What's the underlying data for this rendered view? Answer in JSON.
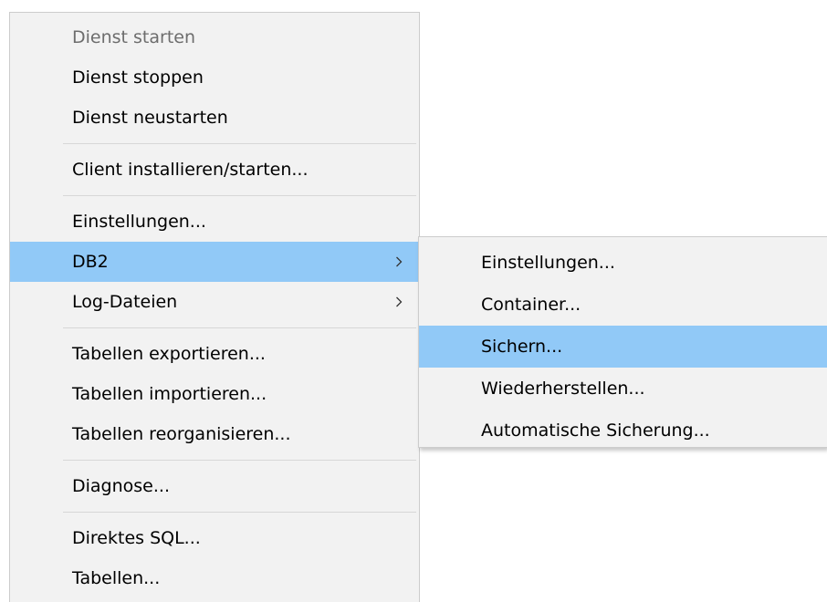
{
  "main_menu": {
    "groups": [
      {
        "items": [
          {
            "label": "Dienst starten"
          },
          {
            "label": "Dienst stoppen"
          },
          {
            "label": "Dienst neustarten"
          }
        ]
      },
      {
        "items": [
          {
            "label": "Client installieren/starten..."
          }
        ]
      },
      {
        "items": [
          {
            "label": "Einstellungen..."
          },
          {
            "label": "DB2",
            "submenu_arrow": "chevron-right-icon"
          },
          {
            "label": "Log-Dateien",
            "submenu_arrow": "chevron-right-icon"
          }
        ]
      },
      {
        "items": [
          {
            "label": "Tabellen exportieren..."
          },
          {
            "label": "Tabellen importieren..."
          },
          {
            "label": "Tabellen reorganisieren..."
          }
        ]
      },
      {
        "items": [
          {
            "label": "Diagnose..."
          }
        ]
      },
      {
        "items": [
          {
            "label": "Direktes SQL..."
          },
          {
            "label": "Tabellen..."
          }
        ]
      }
    ]
  },
  "sub_menu": {
    "items": [
      {
        "label": "Einstellungen..."
      },
      {
        "label": "Container..."
      },
      {
        "label": "Sichern..."
      },
      {
        "label": "Wiederherstellen..."
      },
      {
        "label": "Automatische Sicherung..."
      }
    ]
  },
  "colors": {
    "menu_background": "#f2f2f2",
    "highlight": "#91c9f7",
    "disabled_text": "#6d6d6d",
    "separator": "#d7d7d7"
  }
}
